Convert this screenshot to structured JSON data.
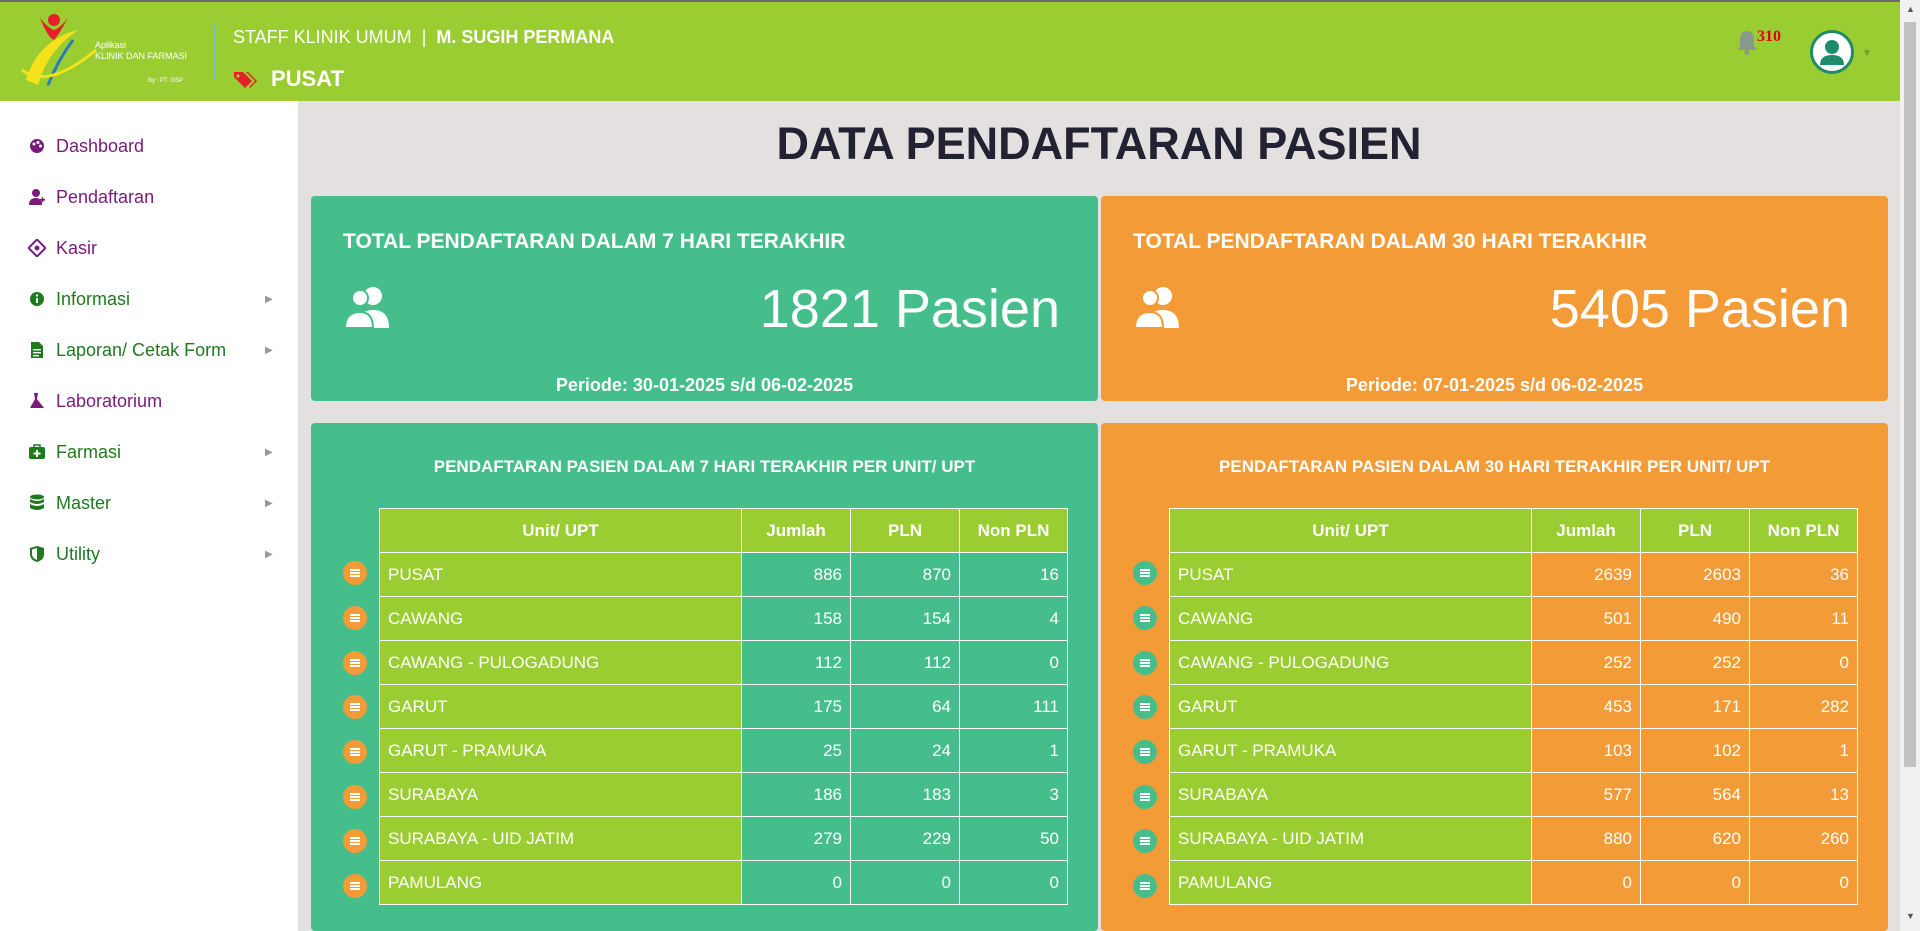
{
  "header": {
    "logo_text_line1": "Aplikasi",
    "logo_text_line2": "KLINIK DAN FARMASI",
    "logo_text_by": "By : PT. GSP",
    "role": "STAFF KLINIK UMUM",
    "separator": "|",
    "user_name": "M. SUGIH PERMANA",
    "location": "PUSAT",
    "notification_count": "310",
    "colors": {
      "header_bg": "#9acd32"
    }
  },
  "sidebar": {
    "items": [
      {
        "label": "Dashboard",
        "icon": "palette-icon",
        "color": "purple",
        "submenu": false
      },
      {
        "label": "Pendaftaran",
        "icon": "user-plus-icon",
        "color": "purple",
        "submenu": false
      },
      {
        "label": "Kasir",
        "icon": "money-icon",
        "color": "purple",
        "submenu": false
      },
      {
        "label": "Informasi",
        "icon": "info-icon",
        "color": "green",
        "submenu": true
      },
      {
        "label": "Laporan/ Cetak Form",
        "icon": "file-icon",
        "color": "green",
        "submenu": true
      },
      {
        "label": "Laboratorium",
        "icon": "flask-icon",
        "color": "purple",
        "submenu": false
      },
      {
        "label": "Farmasi",
        "icon": "medkit-icon",
        "color": "green",
        "submenu": true
      },
      {
        "label": "Master",
        "icon": "database-icon",
        "color": "green",
        "submenu": true
      },
      {
        "label": "Utility",
        "icon": "shield-icon",
        "color": "green",
        "submenu": true
      }
    ]
  },
  "main": {
    "title": "DATA PENDAFTARAN PASIEN",
    "cards": [
      {
        "title": "TOTAL PENDAFTARAN DALAM 7 HARI TERAKHIR",
        "value": "1821 Pasien",
        "period": "Periode: 30-01-2025 s/d 06-02-2025",
        "color": "#45be8b"
      },
      {
        "title": "TOTAL PENDAFTARAN DALAM 30 HARI TERAKHIR",
        "value": "5405 Pasien",
        "period": "Periode: 07-01-2025 s/d 06-02-2025",
        "color": "#f39b37"
      }
    ],
    "table_headers": [
      "Unit/ UPT",
      "Jumlah",
      "PLN",
      "Non PLN"
    ],
    "panels": [
      {
        "title": "PENDAFTARAN PASIEN DALAM 7 HARI TERAKHIR PER UNIT/ UPT",
        "rows": [
          [
            "PUSAT",
            "886",
            "870",
            "16"
          ],
          [
            "CAWANG",
            "158",
            "154",
            "4"
          ],
          [
            "CAWANG - PULOGADUNG",
            "112",
            "112",
            "0"
          ],
          [
            "GARUT",
            "175",
            "64",
            "111"
          ],
          [
            "GARUT - PRAMUKA",
            "25",
            "24",
            "1"
          ],
          [
            "SURABAYA",
            "186",
            "183",
            "3"
          ],
          [
            "SURABAYA - UID JATIM",
            "279",
            "229",
            "50"
          ],
          [
            "PAMULANG",
            "0",
            "0",
            "0"
          ]
        ]
      },
      {
        "title": "PENDAFTARAN PASIEN DALAM 30 HARI TERAKHIR PER UNIT/ UPT",
        "rows": [
          [
            "PUSAT",
            "2639",
            "2603",
            "36"
          ],
          [
            "CAWANG",
            "501",
            "490",
            "11"
          ],
          [
            "CAWANG - PULOGADUNG",
            "252",
            "252",
            "0"
          ],
          [
            "GARUT",
            "453",
            "171",
            "282"
          ],
          [
            "GARUT - PRAMUKA",
            "103",
            "102",
            "1"
          ],
          [
            "SURABAYA",
            "577",
            "564",
            "13"
          ],
          [
            "SURABAYA - UID JATIM",
            "880",
            "620",
            "260"
          ],
          [
            "PAMULANG",
            "0",
            "0",
            "0"
          ]
        ]
      }
    ]
  }
}
